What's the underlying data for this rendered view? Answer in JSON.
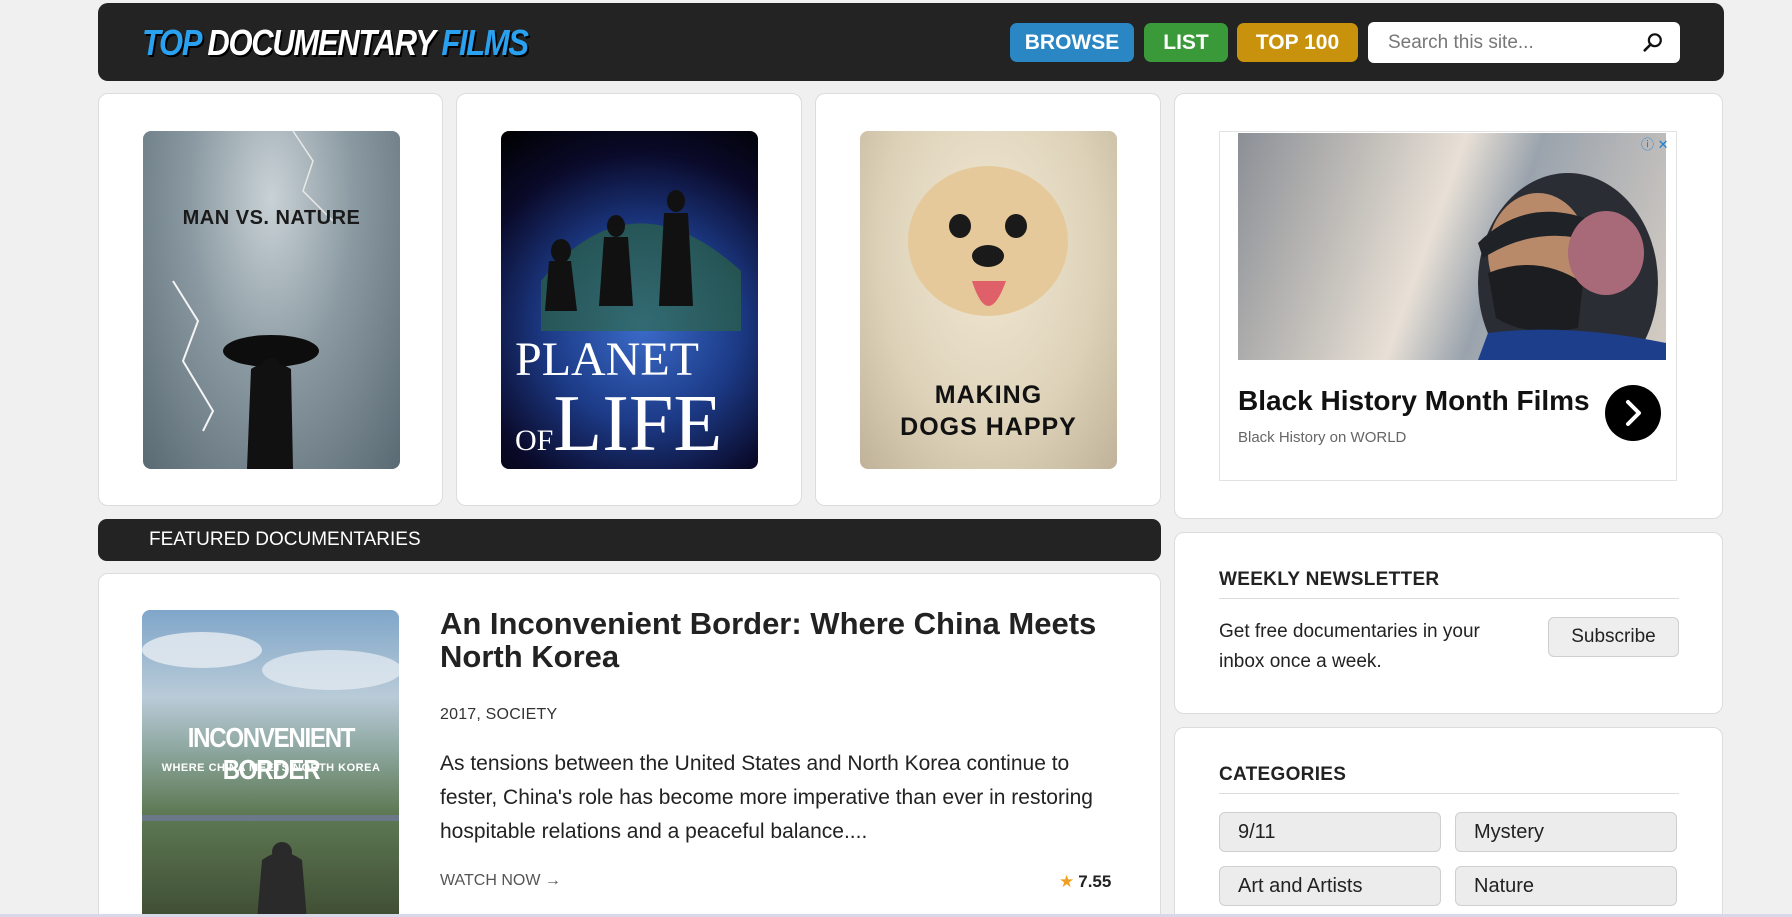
{
  "header": {
    "logo_part1": "TOP",
    "logo_part2": "DOCUMENTARY",
    "logo_part3": "FILMS",
    "nav": {
      "browse": "BROWSE",
      "list": "LIST",
      "top100": "TOP 100"
    },
    "search_placeholder": "Search this site..."
  },
  "posters": [
    {
      "title": "MAN VS. NATURE"
    },
    {
      "title_line1": "PLANET",
      "title_line2_small": "OF",
      "title_line2_big": "LIFE"
    },
    {
      "title_line1": "MAKING",
      "title_line2": "DOGS HAPPY"
    }
  ],
  "ad": {
    "title": "Black History Month Films",
    "subtitle": "Black History on WORLD",
    "icons": "ⓘ ✕"
  },
  "featured": {
    "heading": "FEATURED DOCUMENTARIES",
    "poster_line1": "INCONVENIENT BORDER",
    "poster_line2": "WHERE CHINA MEETS NORTH KOREA",
    "title": "An Inconvenient Border: Where China Meets North Korea",
    "meta": "2017,  SOCIETY",
    "description": "As tensions between the United States and North Korea continue to fester, China's role has become more imperative than ever in restoring hospitable relations and a peaceful balance....",
    "watch_now": "WATCH NOW →",
    "rating_star": "★",
    "rating": "7.55"
  },
  "sidebar": {
    "newsletter_heading": "WEEKLY NEWSLETTER",
    "newsletter_text": "Get free documentaries in your inbox once a week.",
    "subscribe_label": "Subscribe",
    "categories_heading": "CATEGORIES",
    "categories": [
      "9/11",
      "Mystery",
      "Art and Artists",
      "Nature"
    ]
  }
}
